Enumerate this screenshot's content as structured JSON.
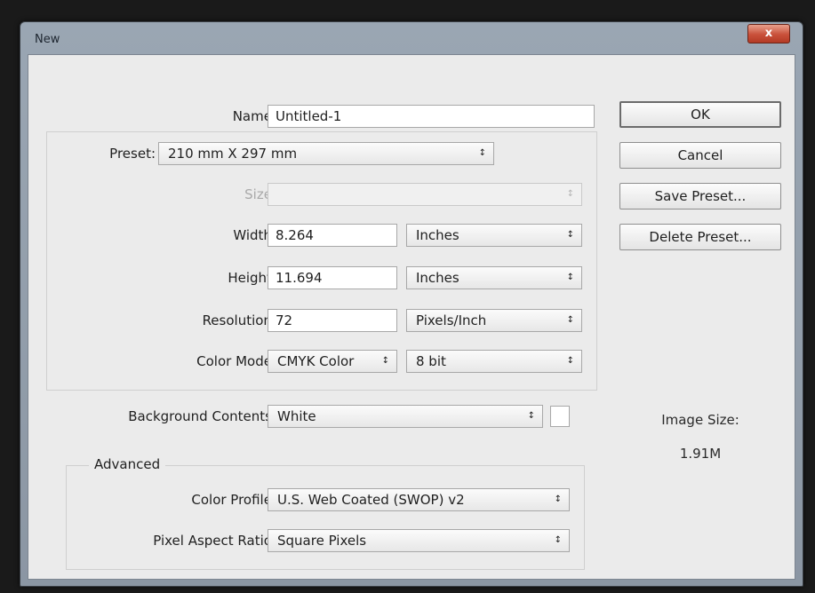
{
  "window": {
    "title": "New",
    "close_glyph": "x"
  },
  "name": {
    "label": "Name:",
    "value": "Untitled-1"
  },
  "preset": {
    "label": "Preset:",
    "value": "210 mm X 297 mm"
  },
  "size": {
    "label": "Size:",
    "value": ""
  },
  "width": {
    "label": "Width:",
    "value": "8.264",
    "unit": "Inches"
  },
  "height": {
    "label": "Height:",
    "value": "11.694",
    "unit": "Inches"
  },
  "resolution": {
    "label": "Resolution:",
    "value": "72",
    "unit": "Pixels/Inch"
  },
  "color_mode": {
    "label": "Color Mode:",
    "value": "CMYK Color",
    "depth": "8 bit"
  },
  "background": {
    "label": "Background Contents:",
    "value": "White",
    "swatch_color": "#ffffff"
  },
  "advanced": {
    "title": "Advanced",
    "color_profile": {
      "label": "Color Profile:",
      "value": "U.S. Web Coated (SWOP) v2"
    },
    "pixel_aspect": {
      "label": "Pixel Aspect Ratio:",
      "value": "Square Pixels"
    }
  },
  "buttons": {
    "ok": "OK",
    "cancel": "Cancel",
    "save_preset": "Save Preset...",
    "delete_preset": "Delete Preset..."
  },
  "image_size": {
    "label": "Image Size:",
    "value": "1.91M"
  },
  "icons": {
    "dropdown": "updown-arrow-icon"
  }
}
